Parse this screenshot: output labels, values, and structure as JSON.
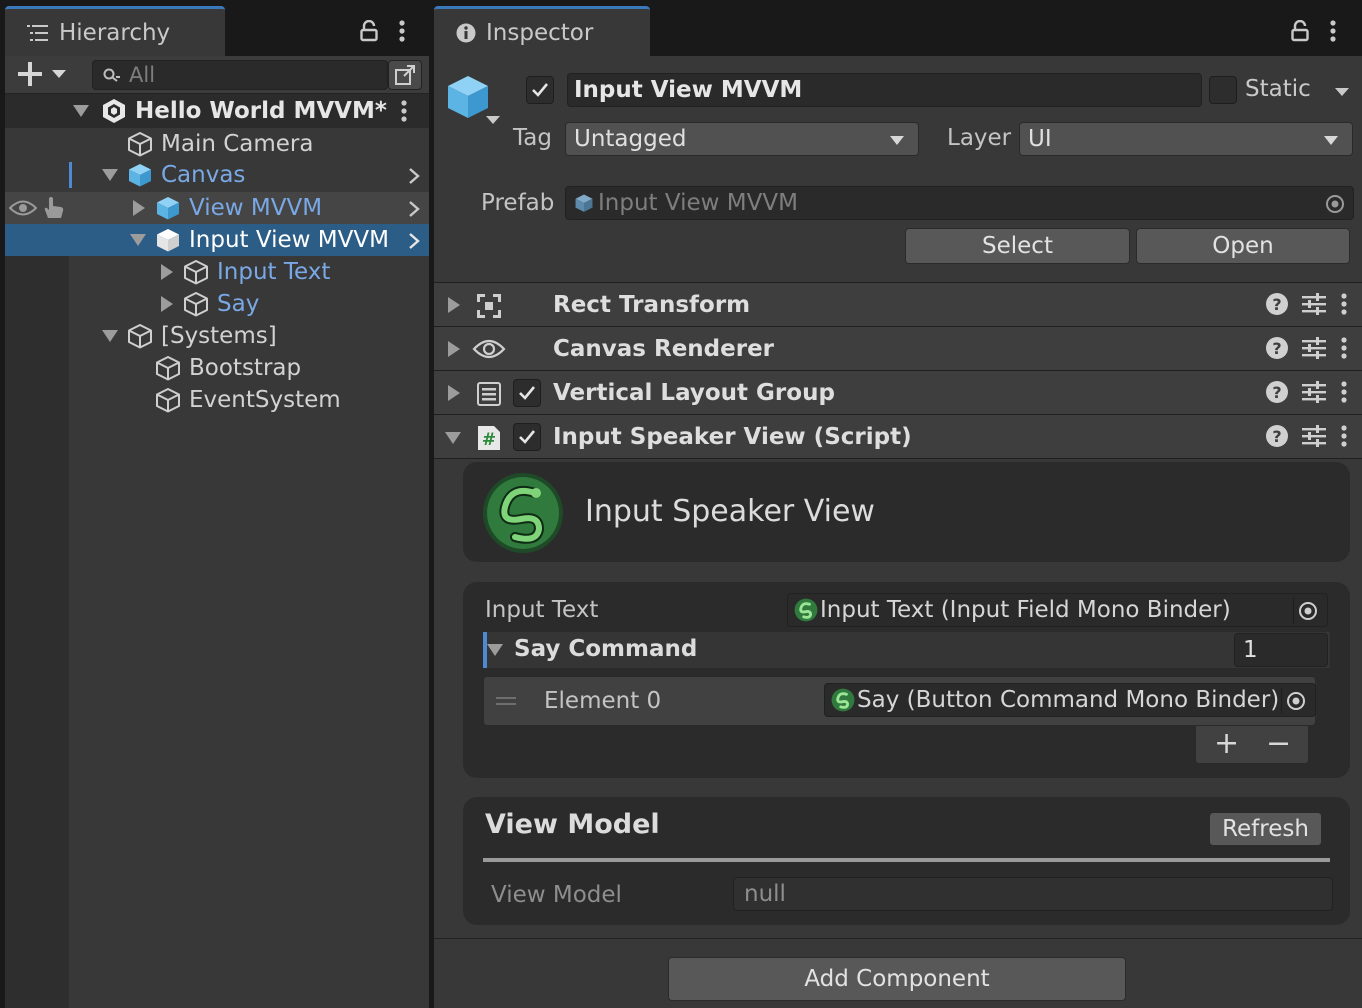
{
  "hierarchy": {
    "tab_label": "Hierarchy",
    "search_placeholder": "All",
    "scene_name": "Hello World MVVM*",
    "items": [
      {
        "label": "Main Camera"
      },
      {
        "label": "Canvas"
      },
      {
        "label": "View MVVM"
      },
      {
        "label": "Input View MVVM"
      },
      {
        "label": "Input Text"
      },
      {
        "label": "Say"
      },
      {
        "label": "[Systems]"
      },
      {
        "label": "Bootstrap"
      },
      {
        "label": "EventSystem"
      }
    ]
  },
  "inspector": {
    "tab_label": "Inspector",
    "object_name": "Input View MVVM",
    "active": true,
    "static_label": "Static",
    "static_checked": false,
    "tag_label": "Tag",
    "tag_value": "Untagged",
    "layer_label": "Layer",
    "layer_value": "UI",
    "prefab_label": "Prefab",
    "prefab_value": "Input View MVVM",
    "select_button": "Select",
    "open_button": "Open",
    "components": [
      {
        "name": "Rect Transform",
        "icon": "rect-transform-icon"
      },
      {
        "name": "Canvas Renderer",
        "icon": "eye-icon"
      },
      {
        "name": "Vertical Layout Group",
        "icon": "layout-icon",
        "enabled": true
      },
      {
        "name": "Input Speaker View (Script)",
        "icon": "script-icon",
        "enabled": true,
        "expanded": true
      }
    ],
    "script": {
      "header_title": "Input Speaker View",
      "input_text_label": "Input Text",
      "input_text_value": "Input Text (Input Field Mono Binder)",
      "say_command_label": "Say Command",
      "say_command_count": "1",
      "element_label": "Element 0",
      "element_value": "Say (Button Command Mono Binder)",
      "add_symbol": "+",
      "remove_symbol": "−"
    },
    "view_model": {
      "section_title": "View Model",
      "refresh_button": "Refresh",
      "field_label": "View Model",
      "field_value": "null"
    },
    "add_component_button": "Add Component"
  },
  "colors": {
    "selection": "#2c5d87",
    "accent_blue": "#3a79bb",
    "prefab_text": "#7aa8e5",
    "panel": "#383838"
  }
}
